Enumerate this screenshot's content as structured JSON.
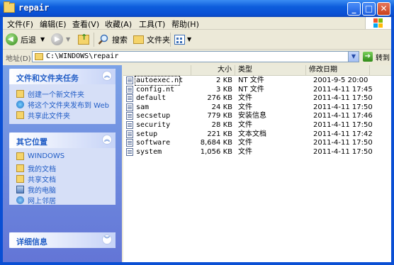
{
  "window": {
    "title": "repair"
  },
  "menu": [
    "文件(F)",
    "编辑(E)",
    "查看(V)",
    "收藏(A)",
    "工具(T)",
    "帮助(H)"
  ],
  "toolbar": {
    "back": "后退",
    "search": "搜索",
    "folders": "文件夹"
  },
  "address": {
    "label": "地址(D)",
    "path": "C:\\WINDOWS\\repair",
    "go": "转到"
  },
  "tasks": {
    "title": "文件和文件夹任务",
    "items": [
      "创建一个新文件夹",
      "将这个文件夹发布到 Web",
      "共享此文件夹"
    ]
  },
  "places": {
    "title": "其它位置",
    "items": [
      "WINDOWS",
      "我的文档",
      "共享文档",
      "我的电脑",
      "网上邻居"
    ]
  },
  "details": {
    "title": "详细信息"
  },
  "columns": {
    "size": "大小",
    "type": "类型",
    "modified": "修改日期"
  },
  "files": [
    {
      "name": "autoexec.nt",
      "size": "2 KB",
      "type": "NT 文件",
      "modified": "2001-9-5 20:00"
    },
    {
      "name": "config.nt",
      "size": "3 KB",
      "type": "NT 文件",
      "modified": "2011-4-11 17:45"
    },
    {
      "name": "default",
      "size": "276 KB",
      "type": "文件",
      "modified": "2011-4-11 17:50"
    },
    {
      "name": "sam",
      "size": "24 KB",
      "type": "文件",
      "modified": "2011-4-11 17:50"
    },
    {
      "name": "secsetup",
      "size": "779 KB",
      "type": "安装信息",
      "modified": "2011-4-11 17:46"
    },
    {
      "name": "security",
      "size": "28 KB",
      "type": "文件",
      "modified": "2011-4-11 17:50"
    },
    {
      "name": "setup",
      "size": "221 KB",
      "type": "文本文档",
      "modified": "2011-4-11 17:42"
    },
    {
      "name": "software",
      "size": "8,684 KB",
      "type": "文件",
      "modified": "2011-4-11 17:50"
    },
    {
      "name": "system",
      "size": "1,056 KB",
      "type": "文件",
      "modified": "2011-4-11 17:50"
    }
  ]
}
